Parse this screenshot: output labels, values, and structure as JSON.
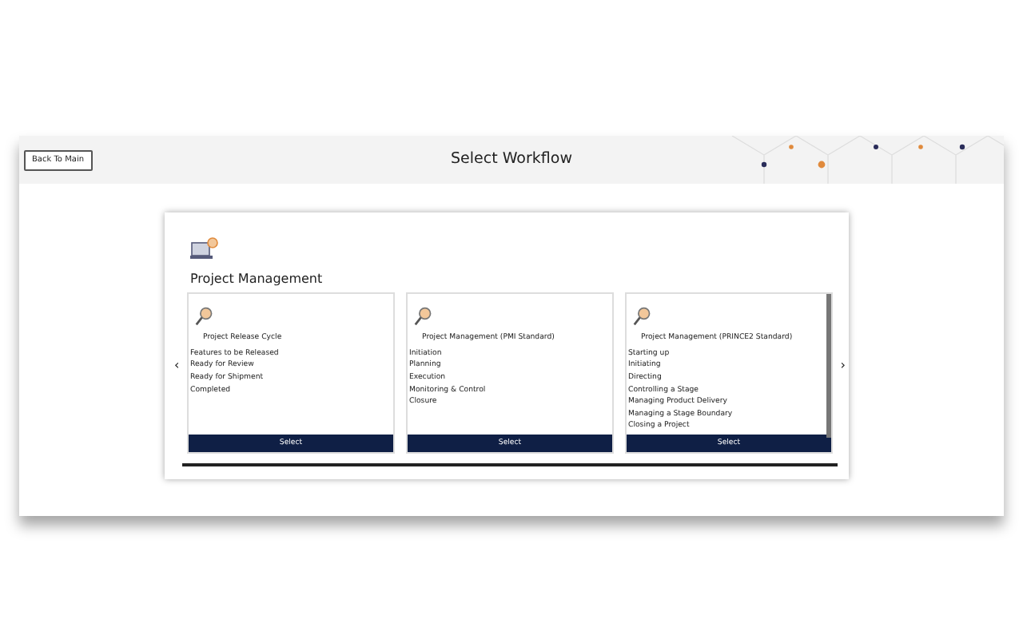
{
  "header": {
    "back_button": "Back To Main",
    "title": "Select Workflow"
  },
  "category": {
    "title": "Project Management"
  },
  "carousel": {
    "prev": "‹",
    "next": "›"
  },
  "workflows": [
    {
      "name": "Project Release Cycle",
      "steps": [
        "Features to be Released",
        "Ready for Review",
        "Ready for Shipment",
        "Completed"
      ],
      "button": "Select",
      "scrollbar": false
    },
    {
      "name": "Project Management (PMI Standard)",
      "steps": [
        "Initiation",
        "Planning",
        "Execution",
        "Monitoring & Control",
        "Closure"
      ],
      "button": "Select",
      "scrollbar": false
    },
    {
      "name": "Project Management (PRINCE2 Standard)",
      "steps": [
        "Starting up",
        "Initiating",
        "Directing",
        "Controlling a Stage",
        "Managing Product Delivery",
        "Managing a Stage Boundary",
        "Closing a Project"
      ],
      "button": "Select",
      "scrollbar": true
    }
  ]
}
